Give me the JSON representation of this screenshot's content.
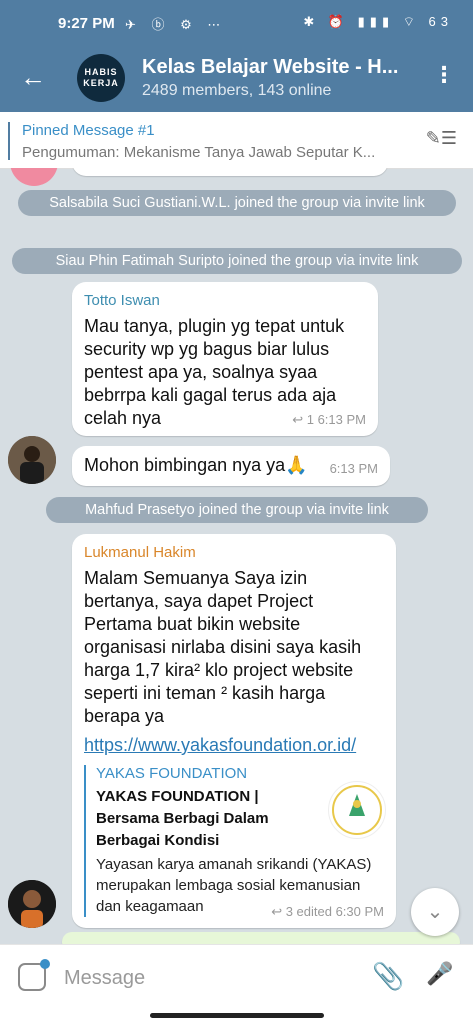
{
  "status_bar": {
    "time": "9:27 PM",
    "left_icons": "✈ ⓑ ⚙ ⋯",
    "right_icons": "✱ ⏰ ▮▮▮ ⌔ 63"
  },
  "header": {
    "title": "Kelas Belajar Website - H...",
    "subtitle": "2489 members, 143 online",
    "avatar_text": "HABIS KERJA"
  },
  "pinned": {
    "title": "Pinned Message #1",
    "text": "Pengumuman: Mekanisme Tanya Jawab Seputar K..."
  },
  "messages": {
    "join1": "Salsabila Suci Gustiani.W.L. joined the group via invite link",
    "join2": "Siau Phin Fatimah Suripto joined the group via invite link",
    "msg1": {
      "sender": "Totto Iswan",
      "text": "Mau tanya, plugin yg tepat untuk security wp yg bagus biar lulus pentest apa ya, soalnya syaa bebrrpa kali gagal terus ada aja celah nya",
      "meta": "↩ 1  6:13 PM"
    },
    "msg2": {
      "text": "Mohon bimbingan nya ya🙏",
      "meta": "6:13 PM"
    },
    "join3": "Mahfud Prasetyo joined the group via invite link",
    "msg3": {
      "sender": "Lukmanul Hakim",
      "text": "Malam Semuanya Saya izin bertanya, saya dapet Project Pertama buat bikin website organisasi nirlaba disini saya kasih harga 1,7 kira² klo project website seperti ini teman ² kasih harga berapa ya",
      "link": "https://www.yakasfoundation.or.id/",
      "preview_site": "YAKAS FOUNDATION",
      "preview_title": "YAKAS FOUNDATION | Bersama Berbagi Dalam Berbagai Kondisi",
      "preview_desc": "Yayasan karya amanah srikandi (YAKAS) merupakan lembaga sosial kemanusian dan keagamaan",
      "meta": "↩ 3  edited 6:30 PM"
    }
  },
  "input": {
    "placeholder": "Message"
  },
  "colors": {
    "header": "#517da2",
    "accent": "#3a8fc7",
    "sender1": "#3e8eb0",
    "sender2": "#d9862a"
  }
}
